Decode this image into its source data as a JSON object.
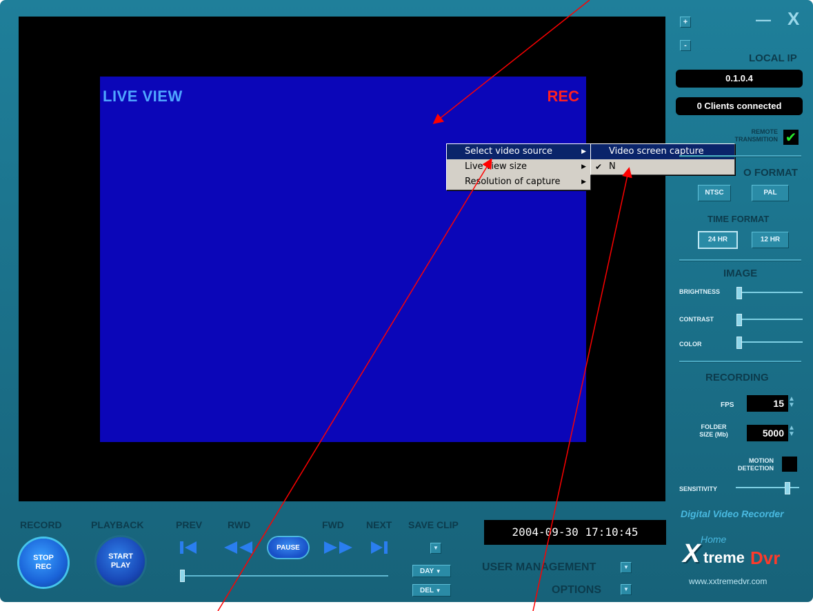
{
  "window": {
    "plus_label": "+",
    "minus_label": "-",
    "minimize_label": "—",
    "close_label": "X"
  },
  "video": {
    "live_label": "LIVE VIEW",
    "rec_label": "REC"
  },
  "context_menu": {
    "items": [
      {
        "label": "Select video source",
        "has_submenu": true,
        "selected": true
      },
      {
        "label": "Live view size",
        "has_submenu": true,
        "selected": false
      },
      {
        "label": "Resolution of capture",
        "has_submenu": true,
        "selected": false
      }
    ],
    "submenu": {
      "items": [
        {
          "label": "Video screen capture",
          "selected": true,
          "checked": false
        },
        {
          "label": "N",
          "selected": false,
          "checked": true
        }
      ]
    }
  },
  "right_panel": {
    "local_ip_label": "LOCAL IP",
    "ip_value": "0.1.0.4",
    "clients_text": "0 Clients connected",
    "remote_label_1": "REMOTE",
    "remote_label_2": "TRANSMITION",
    "remote_checked": true,
    "video_format_label": "O FORMAT",
    "ntsc_label": "NTSC",
    "pal_label": "PAL",
    "time_format_label": "TIME FORMAT",
    "hr24_label": "24 HR",
    "hr12_label": "12 HR",
    "image_label": "IMAGE",
    "brightness_label": "BRIGHTNESS",
    "contrast_label": "CONTRAST",
    "color_label": "COLOR",
    "brightness_value": 0.0,
    "contrast_value": 0.0,
    "color_value": 0.0,
    "recording_label": "RECORDING",
    "fps_label": "FPS",
    "fps_value": "15",
    "folder_label_1": "FOLDER",
    "folder_label_2": "SIZE (Mb)",
    "folder_value": "5000",
    "motion_label_1": "MOTION",
    "motion_label_2": "DETECTION",
    "sensitivity_label": "SENSITIVITY",
    "sensitivity_value": 0.85
  },
  "controls": {
    "record_label": "RECORD",
    "playback_label": "PLAYBACK",
    "prev_label": "PREV",
    "rwd_label": "RWD",
    "fwd_label": "FWD",
    "next_label": "NEXT",
    "save_clip_label": "SAVE CLIP",
    "stop_rec_line1": "STOP",
    "stop_rec_line2": "REC",
    "start_play_line1": "START",
    "start_play_line2": "PLAY",
    "pause_label": "PAUSE",
    "day_label": "DAY",
    "del_label": "DEL",
    "playback_position": 0.0
  },
  "status": {
    "datetime": "2004-09-30 17:10:45"
  },
  "menus": {
    "user_management": "USER MANAGEMENT",
    "options": "OPTIONS"
  },
  "brand": {
    "tagline": "Digital Video Recorder",
    "home_label": "Home",
    "logo_x": "X",
    "logo_treme": "treme",
    "logo_dvr": "Dvr",
    "website": "www.xxtremedvr.com",
    "colors": {
      "dvr": "#ff3a2a",
      "tagline": "#49b9e0"
    }
  }
}
